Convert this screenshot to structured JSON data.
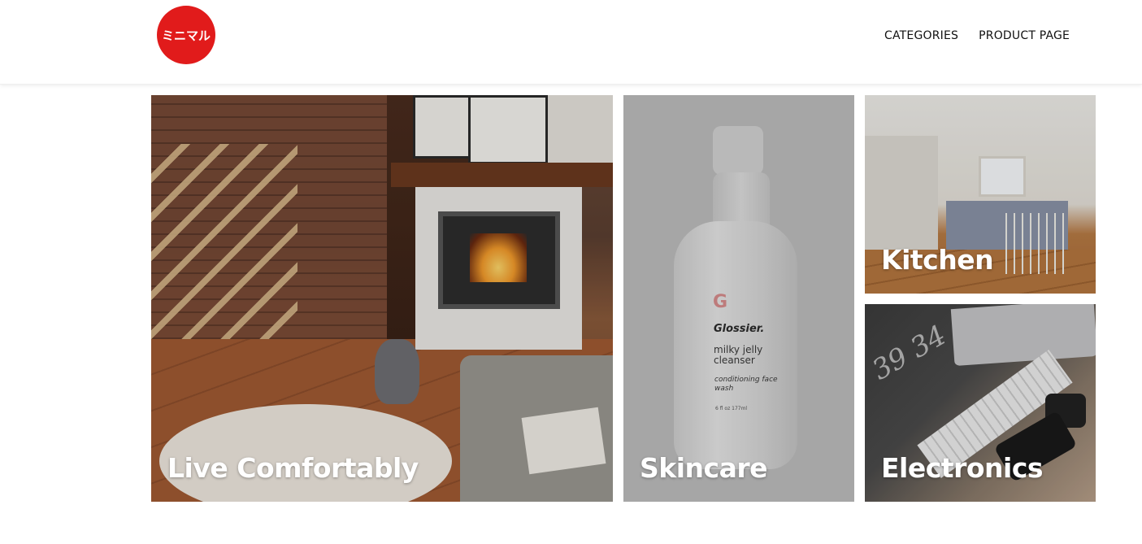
{
  "header": {
    "logo_text": "ミニマル",
    "logo_color": "#e11b1b",
    "nav": [
      {
        "label": "CATEGORIES"
      },
      {
        "label": "PRODUCT PAGE"
      }
    ]
  },
  "tiles": [
    {
      "label": "Live Comfortably"
    },
    {
      "label": "Skincare",
      "product": {
        "brand_mark": "G",
        "brand": "Glossier.",
        "name": "milky jelly cleanser",
        "tagline": "conditioning face wash",
        "volume": "6 fl oz  177ml"
      }
    },
    {
      "label": "Kitchen"
    },
    {
      "label": "Electronics",
      "print_text": "39 34"
    }
  ]
}
